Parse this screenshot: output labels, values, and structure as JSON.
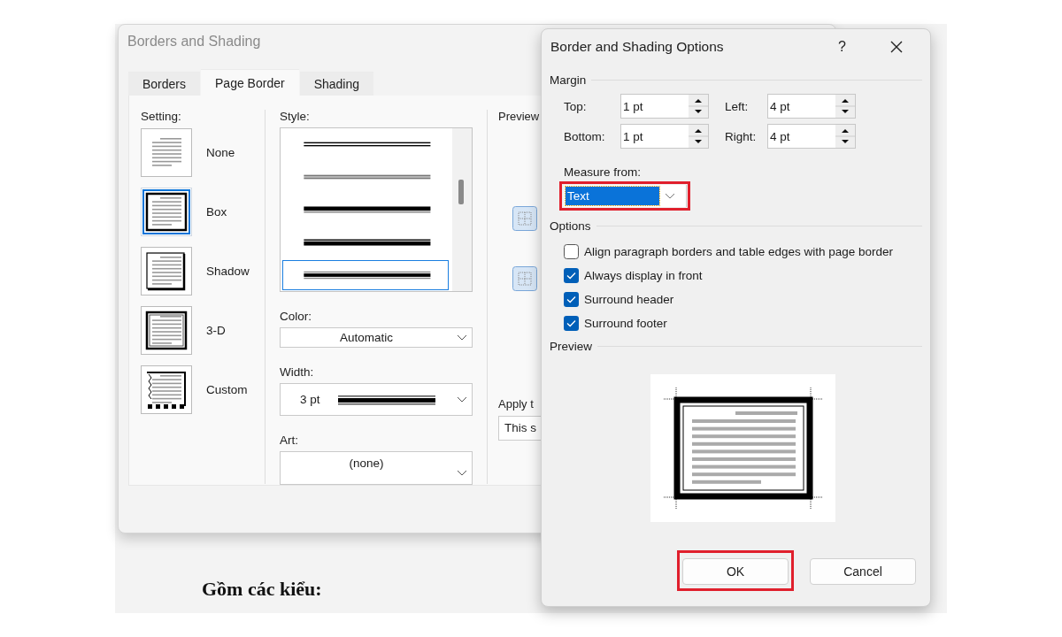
{
  "document": {
    "text": "Gồm các kiểu:"
  },
  "background_dialog": {
    "title": "Borders and Shading",
    "tabs": [
      {
        "label": "Borders",
        "selected": false
      },
      {
        "label": "Page Border",
        "selected": true
      },
      {
        "label": "Shading",
        "selected": false
      }
    ],
    "setting": {
      "label": "Setting:",
      "items": [
        {
          "label": "None",
          "kind": "none",
          "selected": false
        },
        {
          "label": "Box",
          "kind": "box",
          "selected": true
        },
        {
          "label": "Shadow",
          "kind": "shadow",
          "selected": false
        },
        {
          "label": "3-D",
          "kind": "threed",
          "selected": false
        },
        {
          "label": "Custom",
          "kind": "custom",
          "selected": false
        }
      ]
    },
    "style": {
      "label": "Style:",
      "items": [
        {
          "kind": "thin-double",
          "selected": false
        },
        {
          "kind": "grey-double",
          "selected": false
        },
        {
          "kind": "thick-thin",
          "selected": false
        },
        {
          "kind": "thin-thick",
          "selected": false
        },
        {
          "kind": "thick-double",
          "selected": true
        }
      ]
    },
    "color": {
      "label": "Color:",
      "value": "Automatic"
    },
    "width": {
      "label": "Width:",
      "value": "3 pt"
    },
    "art": {
      "label": "Art:",
      "value": "(none)"
    },
    "preview_label": "Preview",
    "apply_to": {
      "label": "Apply t",
      "value": "This s"
    }
  },
  "options_dialog": {
    "title": "Border and Shading Options",
    "help": "?",
    "margin": {
      "label": "Margin",
      "fields": [
        {
          "label": "Top:",
          "value": "1 pt"
        },
        {
          "label": "Left:",
          "value": "4 pt"
        },
        {
          "label": "Bottom:",
          "value": "1 pt"
        },
        {
          "label": "Right:",
          "value": "4 pt"
        }
      ]
    },
    "measure_from": {
      "label": "Measure from:",
      "value": "Text",
      "highlighted": true
    },
    "options": {
      "label": "Options",
      "items": [
        {
          "label": "Align paragraph borders and table edges with page border",
          "checked": false
        },
        {
          "label": "Always display in front",
          "checked": true
        },
        {
          "label": "Surround header",
          "checked": true
        },
        {
          "label": "Surround footer",
          "checked": true
        }
      ]
    },
    "preview_label": "Preview",
    "buttons": [
      {
        "label": "OK",
        "highlighted": true
      },
      {
        "label": "Cancel",
        "highlighted": false
      }
    ]
  }
}
